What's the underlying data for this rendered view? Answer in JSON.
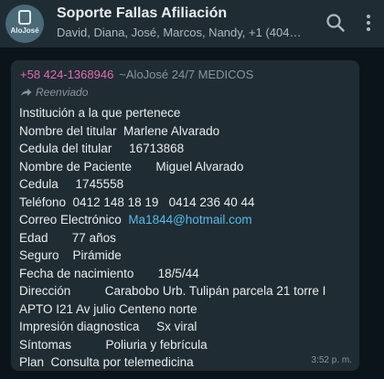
{
  "header": {
    "avatar_text": "AloJosé",
    "title": "Soporte Fallas Afiliación",
    "subtitle": "David, Diana, José, Marcos, Nandy, +1 (404) ..."
  },
  "icons": {
    "search": "search-icon",
    "menu": "more-vertical-icon",
    "forward": "forward-arrow-icon"
  },
  "message": {
    "sender_phone": "+58 424-1368946",
    "sender_name": "~AloJosé 24/7 MEDICOS",
    "forwarded_label": "Reenviado",
    "lines": [
      {
        "label": "Institución a la que pertenece",
        "value": ""
      },
      {
        "label": "Nombre del titular  ",
        "value": "Marlene Alvarado"
      },
      {
        "label": "Cedula del titular     ",
        "value": "16713868"
      },
      {
        "label": "Nombre de Paciente       ",
        "value": "Miguel Alvarado"
      },
      {
        "label": "Cedula     ",
        "value": "1745558"
      },
      {
        "label": "Teléfono  ",
        "value": "0412 148 18 19   0414 236 40 44"
      },
      {
        "label": "Correo Electrónico  ",
        "value": "Ma1844@hotmail.com"
      },
      {
        "label": "Edad       ",
        "value": "77 años"
      },
      {
        "label": "Seguro    ",
        "value": "Pirámide"
      },
      {
        "label": "Fecha de nacimiento       ",
        "value": "18/5/44"
      },
      {
        "label": "Dirección          ",
        "value": "Carabobo Urb. Tulipán parcela 21 torre I"
      },
      {
        "label": "APTO I21 Av julio Centeno norte",
        "value": ""
      },
      {
        "label": "Impresión diagnostica     ",
        "value": "Sx viral"
      },
      {
        "label": "Síntomas          ",
        "value": "Poliuria y febrícula"
      },
      {
        "label": "Plan  ",
        "value": "Consulta por telemedicina"
      }
    ],
    "timestamp": "3:52 p. m."
  },
  "colors": {
    "background": "#0b141a",
    "header": "#202c33",
    "bubble": "#202c33",
    "sender_phone": "#e26ab6",
    "link": "#53bdeb"
  }
}
